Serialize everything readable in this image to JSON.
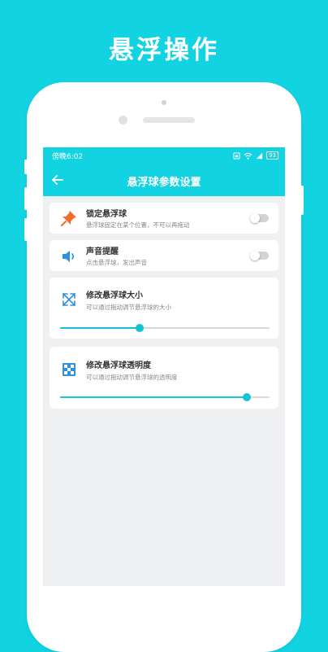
{
  "headline": "悬浮操作",
  "status_bar": {
    "time": "傍晚6:02",
    "battery": "93"
  },
  "app_bar": {
    "title": "悬浮球参数设置",
    "back_icon": "arrow-left-icon"
  },
  "settings": {
    "lock": {
      "icon": "pushpin-icon",
      "title": "锁定悬浮球",
      "subtitle": "悬浮球固定在某个位置，不可以再拖动",
      "enabled": false
    },
    "sound": {
      "icon": "speaker-icon",
      "title": "声音提醒",
      "subtitle": "点击悬浮球，发出声音",
      "enabled": false
    },
    "size": {
      "icon": "resize-arrows-icon",
      "title": "修改悬浮球大小",
      "subtitle": "可以通过拖动调节悬浮球的大小",
      "value_percent": 38
    },
    "opacity": {
      "icon": "transparency-grid-icon",
      "title": "修改悬浮球透明度",
      "subtitle": "可以通过拖动调节悬浮球的透明度",
      "value_percent": 89
    }
  },
  "colors": {
    "accent": "#11d3e2",
    "pin": "#f26b2c",
    "icon_blue": "#2f8fe0"
  }
}
